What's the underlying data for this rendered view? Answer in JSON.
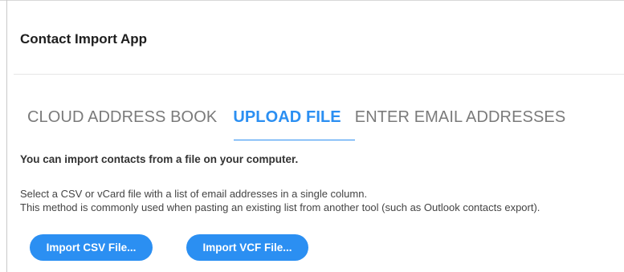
{
  "app": {
    "title": "Contact Import App"
  },
  "tabs": [
    {
      "label": "CLOUD ADDRESS BOOK",
      "active": false
    },
    {
      "label": "UPLOAD FILE",
      "active": true
    },
    {
      "label": "ENTER EMAIL ADDRESSES",
      "active": false
    }
  ],
  "content": {
    "heading": "You can import contacts from a file on your computer.",
    "description_line1": "Select a CSV or vCard file with a list of email addresses in a single column.",
    "description_line2": "This method is commonly used when pasting an existing list from another tool (such as Outlook contacts export)."
  },
  "buttons": {
    "import_csv": "Import CSV File...",
    "import_vcf": "Import VCF File..."
  },
  "colors": {
    "accent": "#2b8ff2",
    "inactive_tab": "#7a7a7a"
  }
}
